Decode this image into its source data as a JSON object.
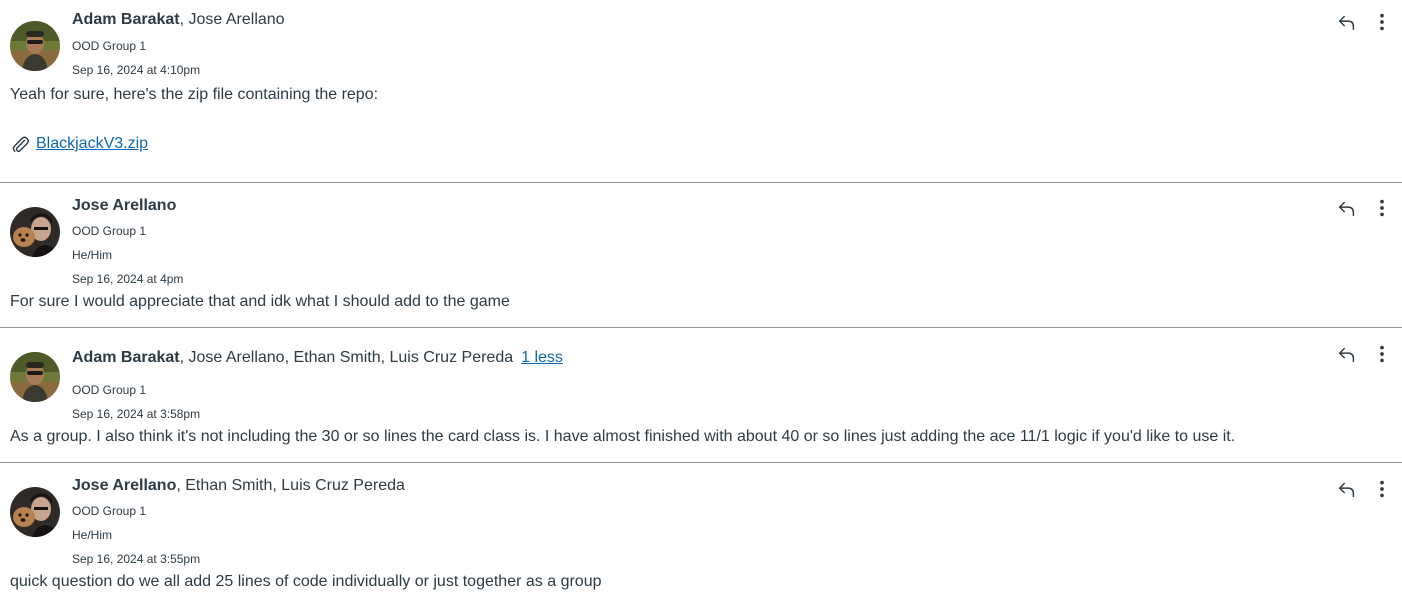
{
  "posts": [
    {
      "primary_author": "Adam Barakat",
      "other_authors": ", Jose Arellano",
      "group": "OOD Group 1",
      "timestamp": "Sep 16, 2024 at 4:10pm",
      "message": "Yeah for sure, here's the zip file containing the repo:",
      "attachment": "BlackjackV3.zip",
      "avatar_icon": "user-avatar-outdoor"
    },
    {
      "primary_author": "Jose Arellano",
      "group": "OOD Group 1",
      "pronouns": "He/Him",
      "timestamp": "Sep 16, 2024 at 4pm",
      "message": "For sure I would appreciate that and idk what I should add to the game",
      "avatar_icon": "user-avatar-dog"
    },
    {
      "primary_author": "Adam Barakat",
      "other_authors": ", Jose Arellano, Ethan Smith, Luis Cruz Pereda",
      "less_link": "1 less",
      "group": "OOD Group 1",
      "timestamp": "Sep 16, 2024 at 3:58pm",
      "message": "As a group. I also think it's not including the 30 or so lines the card class is. I have almost finished with about 40 or so lines just adding the ace 11/1 logic if you'd like to use it.",
      "avatar_icon": "user-avatar-outdoor"
    },
    {
      "primary_author": "Jose Arellano",
      "other_authors": ", Ethan Smith, Luis Cruz Pereda",
      "group": "OOD Group 1",
      "pronouns": "He/Him",
      "timestamp": "Sep 16, 2024 at 3:55pm",
      "message": "quick question do we all add 25 lines of code individually or just together as a group",
      "avatar_icon": "user-avatar-dog"
    }
  ],
  "colors": {
    "text": "#2d3b45",
    "link": "#0e68b3",
    "divider": "#8b969e"
  },
  "icons": {
    "reply": "reply-arrow-icon",
    "more": "vertical-ellipsis-icon",
    "attachment": "paperclip-icon"
  }
}
